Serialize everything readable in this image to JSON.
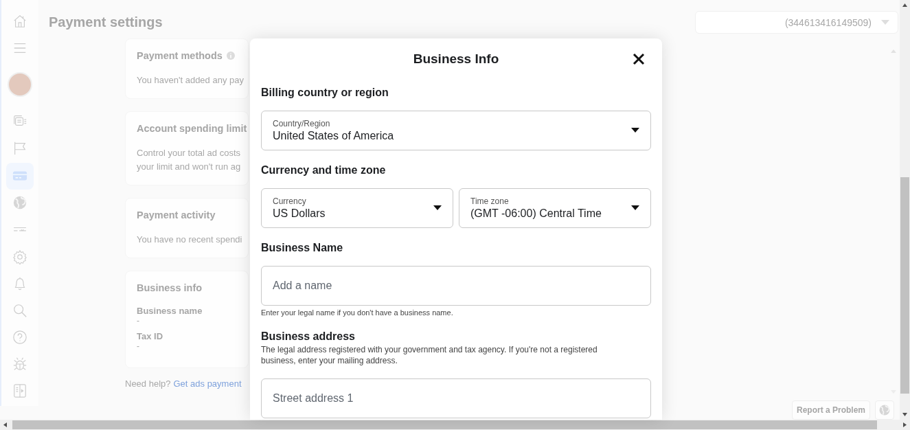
{
  "sidebar": {
    "items": [
      {
        "kind": "home",
        "selected": false
      },
      {
        "kind": "menu",
        "selected": false
      },
      {
        "kind": "avatar",
        "selected": false
      },
      {
        "kind": "ads",
        "selected": false
      },
      {
        "kind": "flag",
        "selected": false
      },
      {
        "kind": "card",
        "selected": true
      },
      {
        "kind": "globe",
        "selected": false
      },
      {
        "kind": "sliders",
        "selected": false
      },
      {
        "kind": "gear",
        "selected": false
      },
      {
        "kind": "bell",
        "selected": false
      },
      {
        "kind": "search",
        "selected": false
      },
      {
        "kind": "help",
        "selected": false
      },
      {
        "kind": "bug",
        "selected": false
      },
      {
        "kind": "panel",
        "selected": false
      }
    ]
  },
  "header": {
    "title": "Payment settings",
    "account": "(344613416149509)"
  },
  "cards": [
    {
      "title": "Payment methods",
      "info": true,
      "lines": [
        "You haven't added any pay"
      ]
    },
    {
      "title": "Account spending limit",
      "lines": [
        "Control your total ad costs",
        "your limit and won't run ag"
      ]
    },
    {
      "title": "Payment activity",
      "lines": [
        "You have no recent spendi"
      ]
    },
    {
      "title": "Business info",
      "fields": [
        {
          "label": "Business name",
          "value": "-"
        },
        {
          "label": "Tax ID",
          "value": "-"
        }
      ]
    }
  ],
  "help": {
    "text": "Need help?",
    "link": "Get ads payment"
  },
  "footer": {
    "report": "Report a Problem"
  },
  "modal": {
    "title": "Business Info",
    "sections": [
      {
        "heading": "Billing country or region",
        "fields": [
          {
            "kind": "select",
            "label": "Country/Region",
            "value": "United States of America"
          }
        ]
      },
      {
        "heading": "Currency and time zone",
        "fields": [
          {
            "kind": "select",
            "label": "Currency",
            "value": "US Dollars"
          },
          {
            "kind": "select",
            "label": "Time zone",
            "value": "(GMT -06:00) Central Time"
          }
        ]
      },
      {
        "heading": "Business Name",
        "fields": [
          {
            "kind": "text",
            "placeholder": "Add a name"
          }
        ],
        "hint": "Enter your legal name if you don't have a business name."
      },
      {
        "heading": "Business address",
        "description": "The legal address registered with your government and tax agency. If you're not a registered business, enter your mailing address.",
        "fields": [
          {
            "kind": "text",
            "placeholder": "Street address 1"
          }
        ]
      }
    ]
  }
}
